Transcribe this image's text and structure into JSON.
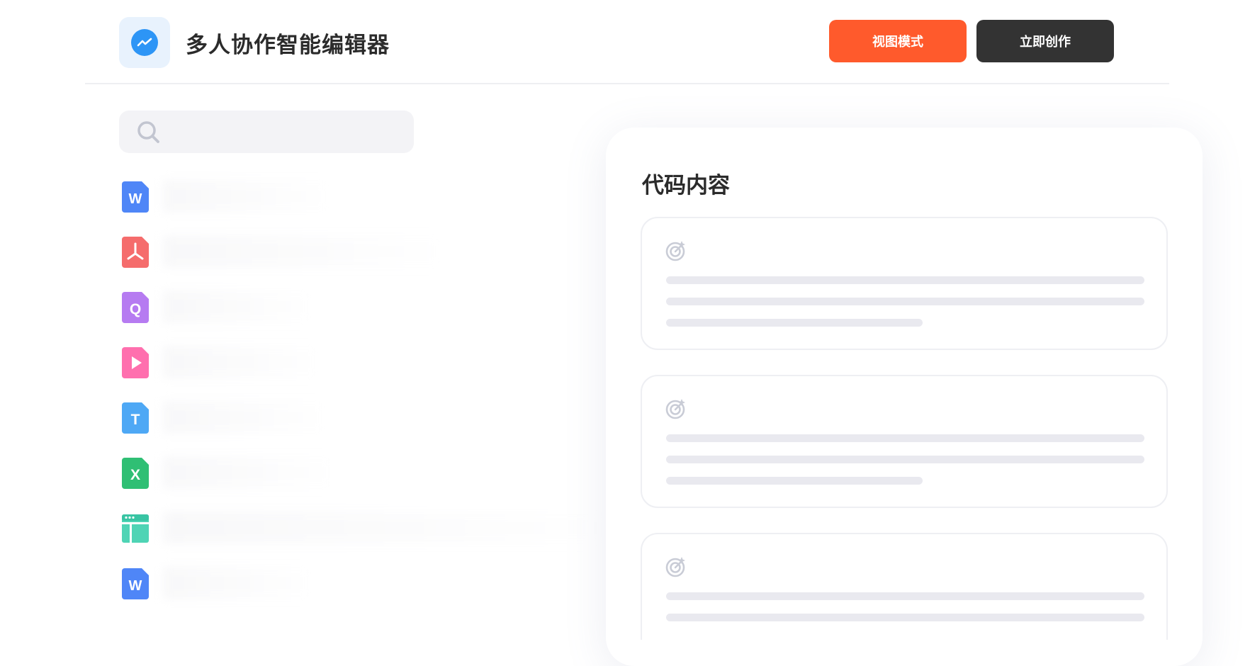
{
  "header": {
    "app_title": "多人协作智能编辑器",
    "logo_icon": "trend-line-icon",
    "buttons": {
      "view_mode_label": "视图模式",
      "create_now_label": "立即创作"
    },
    "colors": {
      "view_mode": "#ff5a2c",
      "create_now": "#333333",
      "logo": "#2d95f6"
    }
  },
  "search": {
    "placeholder": "",
    "icon": "search-icon"
  },
  "files": [
    {
      "type": "word",
      "icon": "word-file-icon",
      "name": "",
      "color": "#4f86f7"
    },
    {
      "type": "pdf",
      "icon": "pdf-file-icon",
      "name": "",
      "color": "#f56c6c"
    },
    {
      "type": "q",
      "icon": "q-file-icon",
      "name": "",
      "color": "#b67bf1"
    },
    {
      "type": "video",
      "icon": "video-file-icon",
      "name": "",
      "color": "#ff6fae"
    },
    {
      "type": "text",
      "icon": "text-file-icon",
      "name": "",
      "color": "#4ea8f5"
    },
    {
      "type": "excel",
      "icon": "excel-file-icon",
      "name": "",
      "color": "#2fbf74"
    },
    {
      "type": "table",
      "icon": "table-layout-icon",
      "name": "",
      "color": "#4fd4b5"
    },
    {
      "type": "word",
      "icon": "word-file-icon",
      "name": "",
      "color": "#4f86f7"
    }
  ],
  "code_panel": {
    "title": "代码内容",
    "cards": [
      {
        "icon": "target-sparkle-icon"
      },
      {
        "icon": "target-sparkle-icon"
      },
      {
        "icon": "target-sparkle-icon"
      }
    ]
  }
}
